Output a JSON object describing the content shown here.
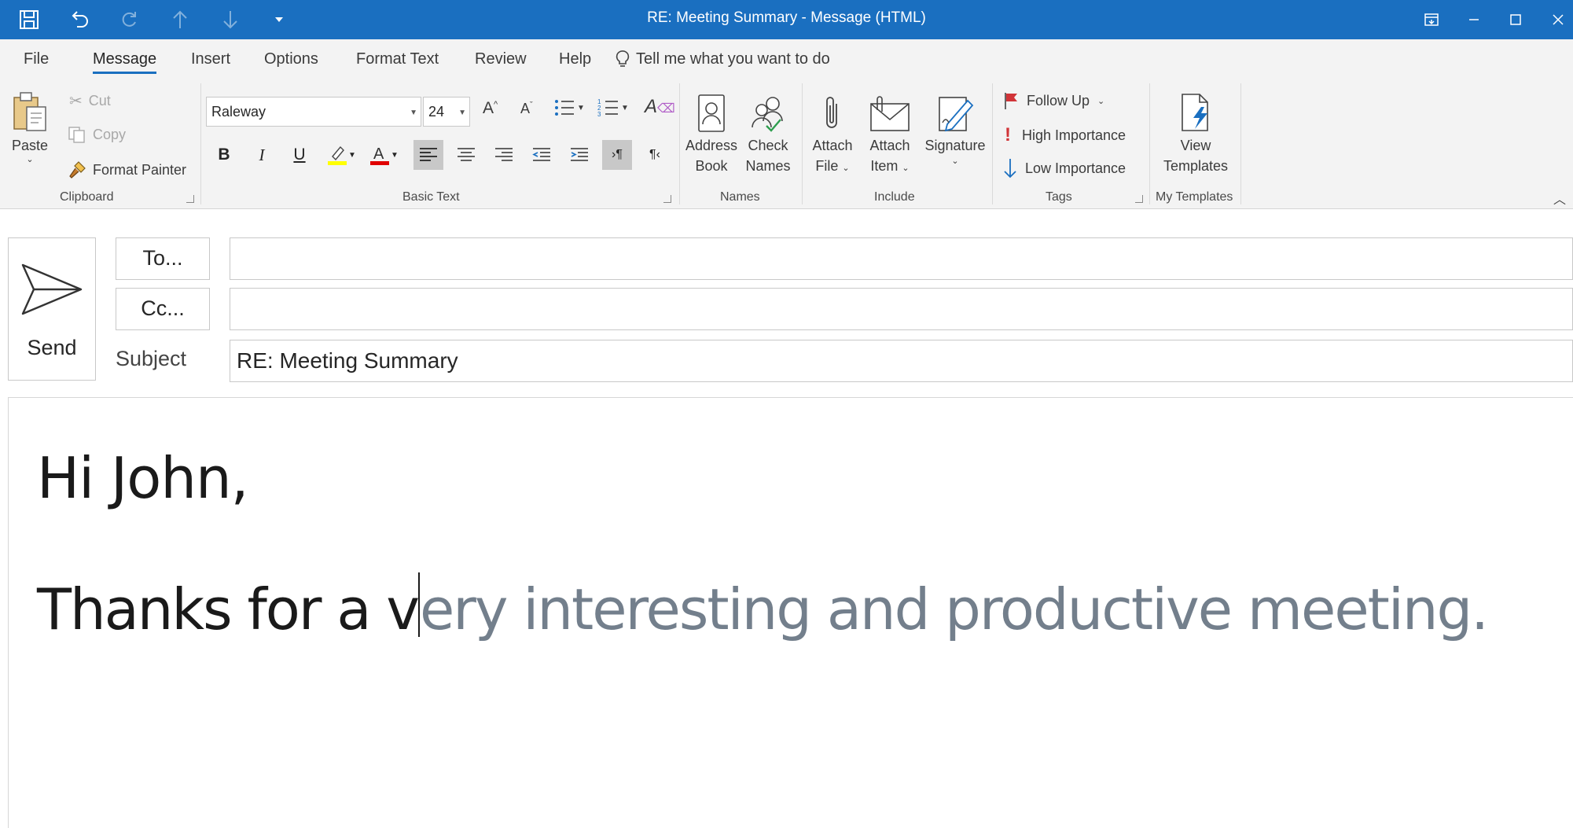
{
  "window": {
    "title": "RE: Meeting Summary  -  Message (HTML)"
  },
  "tabs": [
    "File",
    "Message",
    "Insert",
    "Options",
    "Format Text",
    "Review",
    "Help"
  ],
  "active_tab": "Message",
  "tell_me": "Tell me what you want to do",
  "clipboard": {
    "paste": "Paste",
    "cut": "Cut",
    "copy": "Copy",
    "format_painter": "Format Painter",
    "label": "Clipboard"
  },
  "basic_text": {
    "font": "Raleway",
    "size": "24",
    "label": "Basic Text"
  },
  "names": {
    "address_book": [
      "Address",
      "Book"
    ],
    "check_names": [
      "Check",
      "Names"
    ],
    "label": "Names"
  },
  "include": {
    "attach_file": [
      "Attach",
      "File"
    ],
    "attach_item": [
      "Attach",
      "Item"
    ],
    "signature": "Signature",
    "label": "Include"
  },
  "tags": {
    "follow_up": "Follow Up",
    "high": "High Importance",
    "low": "Low Importance",
    "label": "Tags"
  },
  "templates": {
    "view": [
      "View",
      "Templates"
    ],
    "label": "My Templates"
  },
  "compose": {
    "send": "Send",
    "to": "To...",
    "cc": "Cc...",
    "subject_label": "Subject",
    "subject": "RE: Meeting Summary",
    "to_value": "",
    "cc_value": ""
  },
  "message": {
    "greeting": "Hi John,",
    "typed": "Thanks for a v",
    "suggestion": "ery interesting and productive meeting."
  },
  "colors": {
    "titlebar": "#1a6fc0",
    "highlight": "#ffff00",
    "font_color": "#e00000",
    "follow_up_flag": "#d13438",
    "high_importance": "#d13438",
    "low_importance": "#1a6fc0",
    "suggestion_text": "#737f8c"
  }
}
